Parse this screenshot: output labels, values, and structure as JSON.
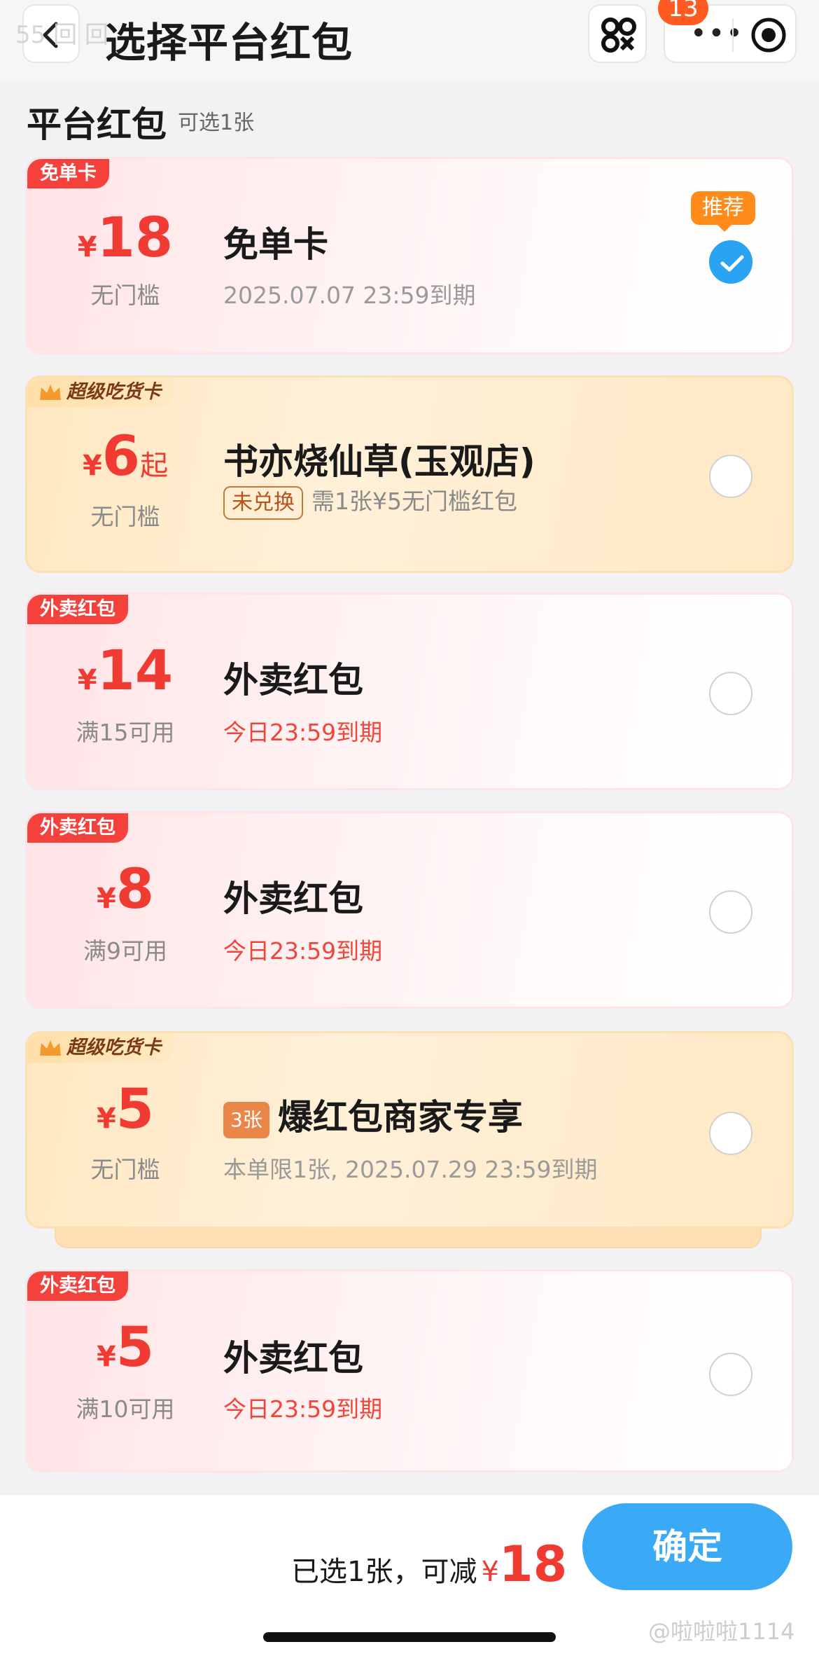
{
  "header": {
    "title": "选择平台红包",
    "watermark_top": "55 回 回",
    "badge_count": "13",
    "more_dots": "•••"
  },
  "section": {
    "title": "平台红包",
    "subtitle": "可选1张"
  },
  "cards": [
    {
      "tag": "免单卡",
      "yen": "¥",
      "amount": "18",
      "suffix": "",
      "condition": "无门槛",
      "name": "免单卡",
      "expire": "2025.07.07 23:59到期",
      "recommended": "推荐",
      "selected": true
    },
    {
      "tag": "超级吃货卡",
      "yen": "¥",
      "amount": "6",
      "suffix": "起",
      "condition": "无门槛",
      "name": "书亦烧仙草(玉观店)",
      "pill": "未兑换",
      "expire": "需1张¥5无门槛红包",
      "selected": false
    },
    {
      "tag": "外卖红包",
      "yen": "¥",
      "amount": "14",
      "suffix": "",
      "condition": "满15可用",
      "name": "外卖红包",
      "expire": "今日23:59到期",
      "selected": false
    },
    {
      "tag": "外卖红包",
      "yen": "¥",
      "amount": "8",
      "suffix": "",
      "condition": "满9可用",
      "name": "外卖红包",
      "expire": "今日23:59到期",
      "selected": false
    },
    {
      "tag": "超级吃货卡",
      "yen": "¥",
      "amount": "5",
      "suffix": "",
      "condition": "无门槛",
      "count": "3张",
      "name": "爆红包商家专享",
      "expire": "本单限1张, 2025.07.29 23:59到期",
      "selected": false
    },
    {
      "tag": "外卖红包",
      "yen": "¥",
      "amount": "5",
      "suffix": "",
      "condition": "满10可用",
      "name": "外卖红包",
      "expire": "今日23:59到期",
      "selected": false
    }
  ],
  "footer": {
    "summary_text": "已选1张，可减",
    "yen": "¥",
    "total": "18",
    "confirm_label": "确定",
    "watermark": "@啦啦啦1114"
  },
  "colors": {
    "accent_red": "#ef3b32",
    "confirm_blue": "#3aa9f6",
    "gold_card": "#ffe8c2"
  }
}
